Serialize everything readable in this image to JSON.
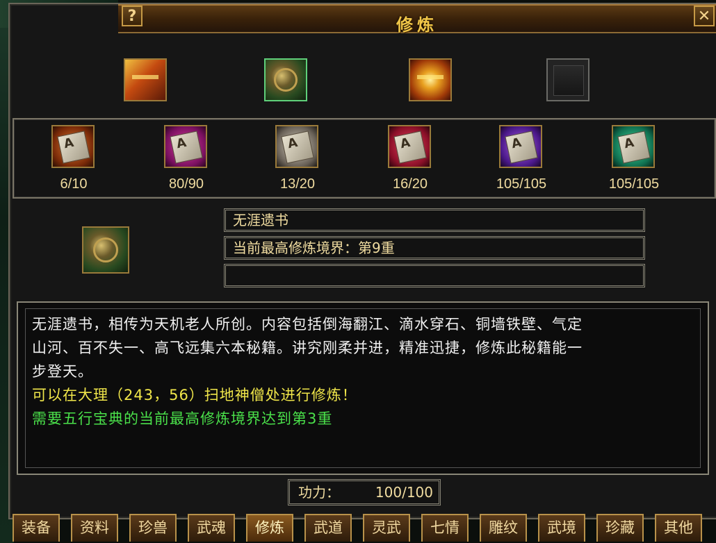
{
  "window": {
    "title": "修炼",
    "help_label": "?",
    "close_label": "✕"
  },
  "books": [
    {
      "icon": "golden-book-icon"
    },
    {
      "icon": "scroll-bundle-icon",
      "selected": true
    },
    {
      "icon": "gold-treasure-book-icon"
    },
    {
      "icon": "empty-slot-icon"
    }
  ],
  "scrolls": [
    {
      "icon": "orange-scroll-icon",
      "glyph": "A",
      "count": "6/10"
    },
    {
      "icon": "pink-scroll-icon",
      "glyph": "A",
      "count": "80/90"
    },
    {
      "icon": "grey-scroll-icon",
      "glyph": "A",
      "count": "13/20"
    },
    {
      "icon": "red-scroll-icon",
      "glyph": "A",
      "count": "16/20"
    },
    {
      "icon": "purple-scroll-icon",
      "glyph": "A",
      "count": "105/105"
    },
    {
      "icon": "green-scroll-icon",
      "glyph": "A",
      "count": "105/105"
    }
  ],
  "detail": {
    "icon": "scroll-bundle-icon",
    "name": "无涯遗书",
    "level": "当前最高修炼境界：第9重",
    "extra": ""
  },
  "description": {
    "line1": "无涯遗书，相传为天机老人所创。内容包括倒海翻江、滴水穿石、铜墙铁壁、气定",
    "line2": "山河、百不失一、高飞远集六本秘籍。讲究刚柔并进，精准迅捷，修炼此秘籍能一",
    "line3": "步登天。",
    "location": "可以在大理（243，56）扫地神僧处进行修炼！",
    "requirement": "需要五行宝典的当前最高修炼境界达到第3重"
  },
  "power": {
    "label": "功力：",
    "value": "100/100"
  },
  "tabs": [
    "装备",
    "资料",
    "珍兽",
    "武魂",
    "修炼",
    "武道",
    "灵武",
    "七情",
    "雕纹",
    "武境",
    "珍藏",
    "其他"
  ],
  "active_tab": "修炼"
}
